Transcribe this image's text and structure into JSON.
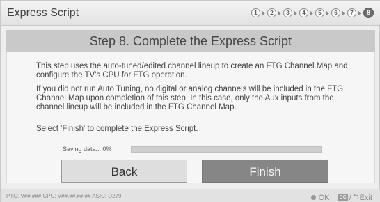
{
  "window": {
    "title": "Express Script"
  },
  "steps": [
    "1",
    "2",
    "3",
    "4",
    "5",
    "6",
    "7",
    "8"
  ],
  "step_header": "Step 8. Complete the Express Script",
  "paragraphs": [
    "This step uses the auto-tuned/edited channel lineup to create an FTG Channel Map and configure the TV's CPU for FTG operation.",
    "If you did not run Auto Tuning, no digital or analog channels will be included in the FTG Channel Map upon completion of this step. In this case, only the Aux inputs from the channel lineup will be included in the FTG Channel Map.",
    "Select 'Finish' to complete the Express Script."
  ],
  "progress": {
    "label": "Saving data... 0%",
    "value": 0
  },
  "buttons": {
    "back": "Back",
    "finish": "Finish"
  },
  "footer": {
    "versions": "PTC: V##.### CPU: V##.##.##.## ASIC: D279",
    "ok": "OK",
    "cc": "CC",
    "slash": "/",
    "back_glyph": "⮌",
    "exit": "Exit"
  },
  "colors": {
    "active_step": "#6d6d6d",
    "finish_button": "#868686",
    "header_band": "#c9c9c9"
  }
}
